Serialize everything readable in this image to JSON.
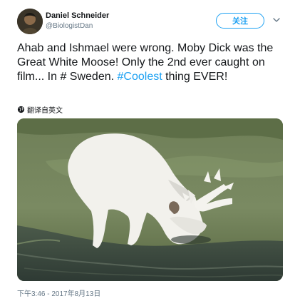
{
  "tweet": {
    "author_name": "Daniel Schneider",
    "author_handle": "@BiologistDan",
    "follow_label": "关注",
    "text_plain_1": "Ahab and Ishmael were wrong. Moby Dick was the Great White Moose! Only the 2nd ever caught on film... In # Sweden. ",
    "hashtag": "#Coolest",
    "text_plain_2": " thing EVER!",
    "translate_label": "翻译自英文",
    "timestamp": "下午3:46 - 2017年8月13日"
  },
  "colors": {
    "accent": "#1da1f2",
    "text": "#14171a",
    "secondary": "#657786"
  },
  "icons": {
    "translate": "globe-icon",
    "menu": "chevron-down-icon"
  }
}
